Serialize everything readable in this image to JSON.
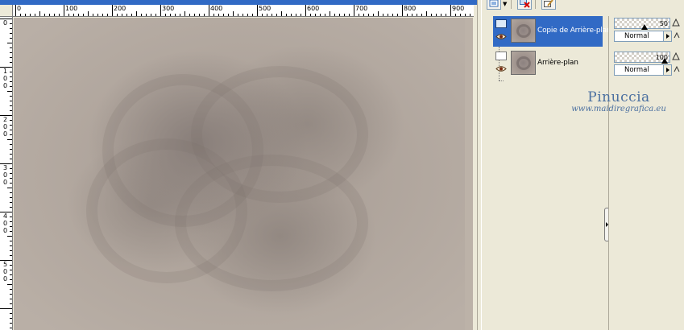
{
  "app": {
    "ruler": {
      "h_labels": [
        "0",
        "100",
        "200",
        "300",
        "400",
        "500",
        "600",
        "700",
        "800",
        "900"
      ],
      "v_labels": [
        [
          "0"
        ],
        [
          "1",
          "0",
          "0"
        ],
        [
          "2",
          "0",
          "0"
        ],
        [
          "3",
          "0",
          "0"
        ],
        [
          "4",
          "0",
          "0"
        ],
        [
          "5",
          "0",
          "0"
        ]
      ]
    }
  },
  "layers_palette": {
    "toolbar": {
      "new_layer_icon": "new-raster-layer-icon",
      "delete_icon": "delete-layer-icon",
      "properties_icon": "layer-properties-icon"
    },
    "layers": [
      {
        "name": "Copie de Arrière-plan",
        "selected": true,
        "visible": true,
        "opacity": "50",
        "opacity_level": 0.5,
        "blend_mode": "Normal"
      },
      {
        "name": "Arrière-plan",
        "selected": false,
        "visible": true,
        "opacity": "100",
        "opacity_level": 1.0,
        "blend_mode": "Normal"
      }
    ]
  },
  "watermark": {
    "title": "Pinuccia",
    "url": "www.maidiregrafica.eu"
  },
  "colors": {
    "selection": "#316ac5",
    "panel_bg": "#ece9d8",
    "canvas_tone": "#b2a79e"
  }
}
